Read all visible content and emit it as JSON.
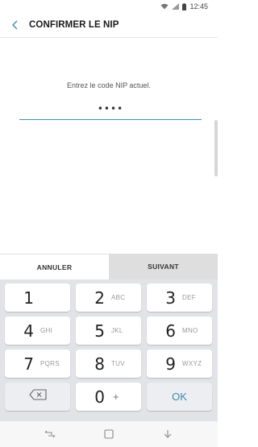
{
  "status_bar": {
    "time": "12:45"
  },
  "app_bar": {
    "title": "CONFIRMER LE NIP"
  },
  "content": {
    "prompt": "Entrez le code NIP actuel.",
    "pin_masked": "••••"
  },
  "actions": {
    "cancel_label": "ANNULER",
    "next_label": "SUIVANT"
  },
  "keypad": {
    "keys": [
      {
        "num": "1",
        "letters": ""
      },
      {
        "num": "2",
        "letters": "ABC"
      },
      {
        "num": "3",
        "letters": "DEF"
      },
      {
        "num": "4",
        "letters": "GHI"
      },
      {
        "num": "5",
        "letters": "JKL"
      },
      {
        "num": "6",
        "letters": "MNO"
      },
      {
        "num": "7",
        "letters": "PQRS"
      },
      {
        "num": "8",
        "letters": "TUV"
      },
      {
        "num": "9",
        "letters": "WXYZ"
      }
    ],
    "zero": {
      "num": "0",
      "letters": "+"
    },
    "ok_label": "OK"
  },
  "icons": {
    "back": "back-arrow-icon",
    "backspace": "backspace-icon",
    "wifi": "wifi-icon",
    "signal": "signal-icon",
    "battery": "battery-icon",
    "recents": "recents-icon",
    "home": "home-icon",
    "nav_back": "nav-back-icon"
  },
  "colors": {
    "accent": "#3a8fb7",
    "ok_text": "#3c89b0",
    "keypad_bg": "#e1e3e6"
  }
}
